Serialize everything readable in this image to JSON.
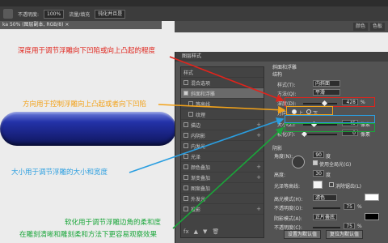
{
  "optbar": {
    "opacity_label": "不透明度:",
    "opacity": "100%",
    "fill_label": "流量/填充",
    "align_label": "钝化并且是"
  },
  "document_tab": "ka 50% (图层副本, RGB/8) ×",
  "panel_tabs": [
    "颜色",
    "色板"
  ],
  "dialog": {
    "title": "图层样式",
    "list": [
      {
        "label": "样式",
        "checked": false
      },
      {
        "label": "混合选项",
        "checked": false
      },
      {
        "label": "斜面和浮雕",
        "checked": true,
        "selected": true
      },
      {
        "label": "等高线",
        "checked": false,
        "indent": true
      },
      {
        "label": "纹理",
        "checked": false,
        "indent": true
      },
      {
        "label": "描边",
        "checked": false,
        "plus": true
      },
      {
        "label": "内阴影",
        "checked": false,
        "plus": true
      },
      {
        "label": "内发光",
        "checked": false
      },
      {
        "label": "光泽",
        "checked": false
      },
      {
        "label": "颜色叠加",
        "checked": false,
        "plus": true
      },
      {
        "label": "渐变叠加",
        "checked": false,
        "plus": true
      },
      {
        "label": "图案叠加",
        "checked": false
      },
      {
        "label": "外发光",
        "checked": false
      },
      {
        "label": "投影",
        "checked": false,
        "plus": true
      }
    ],
    "fx_label": "fx",
    "props": {
      "section": "斜面和浮雕",
      "structure": "结构",
      "style_label": "样式(T):",
      "style_value": "内斜面",
      "technique_label": "方法(Q):",
      "technique_value": "平滑",
      "depth_label": "深度(D):",
      "depth_value": "428",
      "depth_unit": "%",
      "depth_level": 0.62,
      "direction_label": "方向:",
      "up_label": "上",
      "down_label": "下",
      "size_label": "大小(Z):",
      "size_value": "45",
      "size_unit": "像素",
      "size_level": 0.3,
      "soften_label": "软化(F):",
      "soften_value": "0",
      "soften_unit": "像素",
      "soften_level": 0.02,
      "shading": "阴影",
      "angle_label": "角度(N):",
      "angle_value": "90",
      "angle_unit": "度",
      "global_light": "使用全局光(G)",
      "altitude_label": "高度:",
      "altitude_value": "30",
      "altitude_unit": "度",
      "gloss_label": "光泽等高线:",
      "antialias": "消除锯齿(L)",
      "highlight_label": "高光模式(H):",
      "highlight_mode": "滤色",
      "highlight_opacity_label": "不透明度(O):",
      "highlight_opacity": "75",
      "shadow_label": "阴影模式(A):",
      "shadow_mode": "正片叠底",
      "shadow_opacity_label": "不透明度(C):",
      "shadow_opacity": "75",
      "pct": "%",
      "btn_default": "设置为默认值",
      "btn_reset": "复位为默认值"
    }
  },
  "annotations": {
    "depth": "深度用于调节浮雕向下凹陷或向上凸起的程度",
    "direction": "方向用于控制浮雕向上凸起或者向下凹陷",
    "size": "大小用于调节浮雕的大小和宽度",
    "soften_1": "软化用于调节浮雕边角的柔和度",
    "soften_2": "在雕刻清晰和雕刻柔和方法下更容易观察效果"
  },
  "colors": {
    "red": "#e0241c",
    "orange": "#f2a21a",
    "blue": "#2a9ee0",
    "green": "#1aa63a",
    "highlight_swatch": "#ffffff",
    "shadow_swatch": "#000000"
  }
}
